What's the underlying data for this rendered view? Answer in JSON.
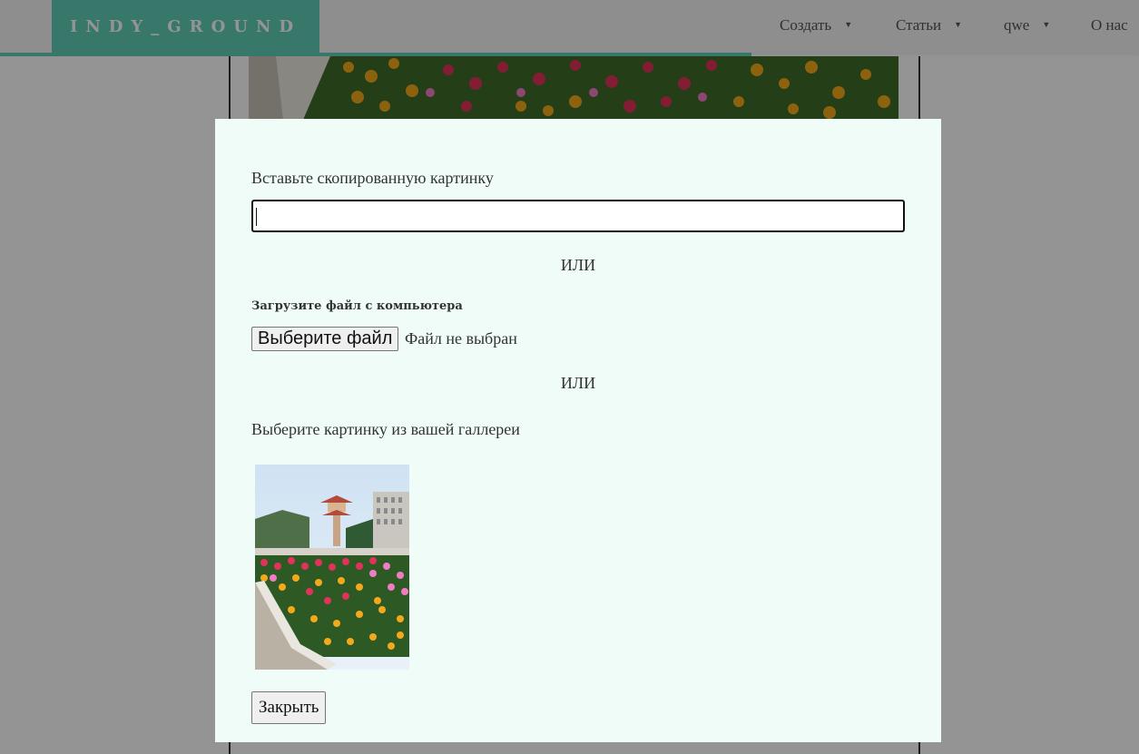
{
  "header": {
    "logo": "INDY_GROUND",
    "nav": [
      {
        "label": "Создать",
        "caret": "▼"
      },
      {
        "label": "Статьи",
        "caret": "▼"
      },
      {
        "label": "qwe",
        "caret": "▼"
      },
      {
        "label": "О нас"
      }
    ]
  },
  "modal": {
    "paste_label": "Вставьте скопированную картинку",
    "paste_value": "",
    "or_text": "ИЛИ",
    "upload_label": "Загрузите файл с компьютера",
    "file_button": "Выберите файл",
    "file_status": "Файл не выбран",
    "gallery_label": "Выберите картинку из вашей галлереи",
    "close_button": "Закрыть"
  },
  "colors": {
    "accent": "#5fcfb9",
    "modal_bg": "#effcf7",
    "overlay": "rgba(0,0,0,0.42)"
  }
}
